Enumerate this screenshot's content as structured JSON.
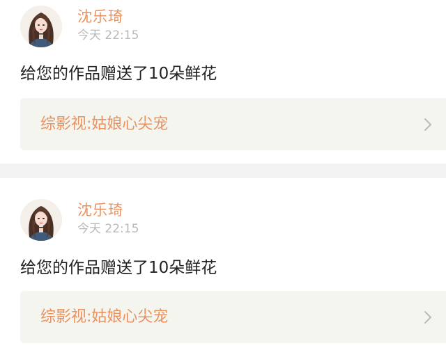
{
  "notifications": [
    {
      "user_name": "沈乐琦",
      "timestamp": "今天 22:15",
      "message": "给您的作品赠送了10朵鲜花",
      "work_title": "综影视:姑娘心尖宠",
      "avatar_icon": "user-avatar-icon",
      "chevron_icon": "chevron-right-icon"
    },
    {
      "user_name": "沈乐琦",
      "timestamp": "今天 22:15",
      "message": "给您的作品赠送了10朵鲜花",
      "work_title": "综影视:姑娘心尖宠",
      "avatar_icon": "user-avatar-icon",
      "chevron_icon": "chevron-right-icon"
    }
  ],
  "colors": {
    "accent": "#e9925f",
    "timestamp": "#b9b9b9",
    "message_text": "#222222",
    "link_background": "#f5f5f0",
    "divider": "#f3f3f3"
  }
}
